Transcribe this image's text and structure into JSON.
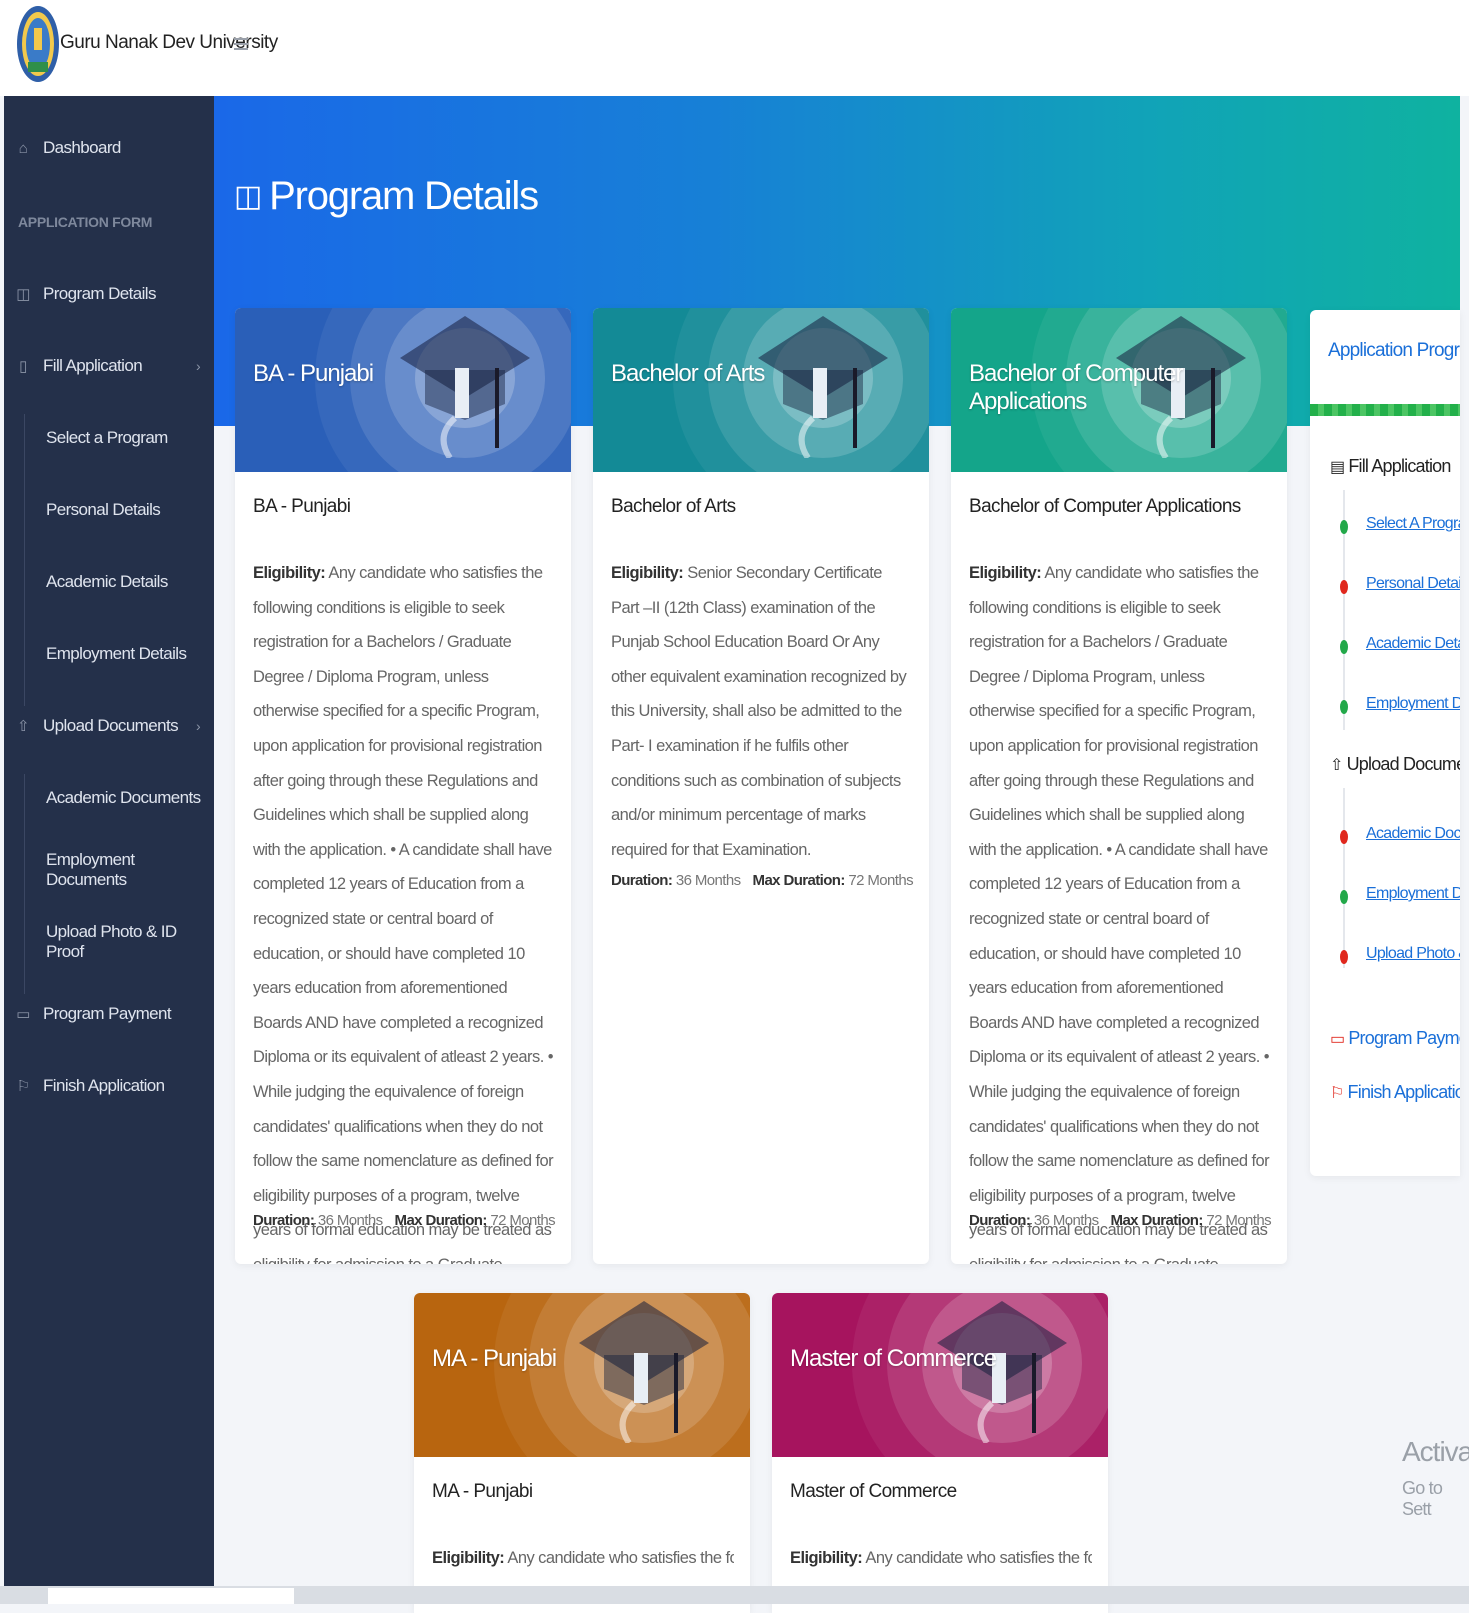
{
  "header": {
    "brand": "Guru Nanak Dev University",
    "logo_icon": "university-seal-icon",
    "menu_icon": "hamburger-icon"
  },
  "sidebar": {
    "dashboard": "Dashboard",
    "section_heading": "APPLICATION FORM",
    "program_details": "Program Details",
    "fill_application": "Fill Application",
    "fill_sub": [
      "Select a Program",
      "Personal Details",
      "Academic Details",
      "Employment Details"
    ],
    "upload_documents": "Upload Documents",
    "upload_sub": [
      "Academic Documents",
      "Employment Documents",
      "Upload Photo & ID Proof"
    ],
    "program_payment": "Program Payment",
    "finish_application": "Finish Application"
  },
  "hero": {
    "title": "Program Details",
    "icon": "book-icon"
  },
  "labels": {
    "eligibility": "Eligibility:",
    "duration": "Duration:",
    "max_duration": "Max Duration:"
  },
  "programs": [
    {
      "head_title": "BA - Punjabi",
      "name": "BA - Punjabi",
      "eligibility": "Any candidate who satisfies the following conditions is eligible to seek registration for a Bachelors / Graduate Degree / Diploma Program, unless otherwise specified for a specific Program, upon application for provisional registration after going through these Regulations and Guidelines which shall be supplied along with the application. • A candidate shall have completed 12 years of Education from a recognized state or central board of education, or should have completed 10 years education from aforementioned Boards AND have completed a recognized Diploma or its equivalent of atleast 2 years. • While judging the equivalence of foreign candidates' qualifications when they do not follow the same nomenclature as defined for eligibility purposes of a program, twelve years of formal education may be treated as eligibility for admission to a Graduate Degree.",
      "duration": "36 Months",
      "max_duration": "72 Months",
      "color": "#2a5fb8"
    },
    {
      "head_title": "Bachelor of Arts",
      "name": "Bachelor of Arts",
      "eligibility": "Senior Secondary Certificate Part –II (12th Class) examination of the Punjab School Education Board Or Any other equivalent examination recognized by this University, shall also be admitted to the Part- I examination if he fulfils other conditions such as combination of subjects and/or minimum percentage of marks required for that Examination.",
      "duration": "36 Months",
      "max_duration": "72 Months",
      "color": "#138a96"
    },
    {
      "head_title": "Bachelor of Computer Applications",
      "name": "Bachelor of Computer Applications",
      "eligibility": "Any candidate who satisfies the following conditions is eligible to seek registration for a Bachelors / Graduate Degree / Diploma Program, unless otherwise specified for a specific Program, upon application for provisional registration after going through these Regulations and Guidelines which shall be supplied along with the application. • A candidate shall have completed 12 years of Education from a recognized state or central board of education, or should have completed 10 years education from aforementioned Boards AND have completed a recognized Diploma or its equivalent of atleast 2 years. • While judging the equivalence of foreign candidates' qualifications when they do not follow the same nomenclature as defined for eligibility purposes of a program, twelve years of formal education may be treated as eligibility for admission to a Graduate Degree.",
      "duration": "36 Months",
      "max_duration": "72 Months",
      "color": "#14a58a"
    },
    {
      "head_title": "MA - Punjabi",
      "name": "MA - Punjabi",
      "eligibility": "Any candidate who satisfies the following conditions is eligible to seek registration",
      "color": "#b8650f"
    },
    {
      "head_title": "Master of Commerce",
      "name": "Master of Commerce",
      "eligibility": "Any candidate who satisfies the following conditions is eligible to seek registration",
      "color": "#a6145e"
    }
  ],
  "progress": {
    "title": "Application Progress I",
    "fill_application": "Fill Application",
    "fill_links": [
      {
        "label": "Select A Program",
        "status": "green"
      },
      {
        "label": "Personal Details",
        "status": "red"
      },
      {
        "label": "Academic Details",
        "status": "green"
      },
      {
        "label": "Employment Detail",
        "status": "green"
      }
    ],
    "upload_documents": "Upload Documents",
    "upload_links": [
      {
        "label": "Academic Docume",
        "status": "red"
      },
      {
        "label": "Employment Docu",
        "status": "green"
      },
      {
        "label": "Upload Photo & ID",
        "status": "red"
      }
    ],
    "program_payment": "Program Payment",
    "finish_application": "Finish Application",
    "green": "#23a84a",
    "red": "#e0281e"
  },
  "watermark": {
    "line1": "Activate",
    "line2": "Go to Sett"
  }
}
